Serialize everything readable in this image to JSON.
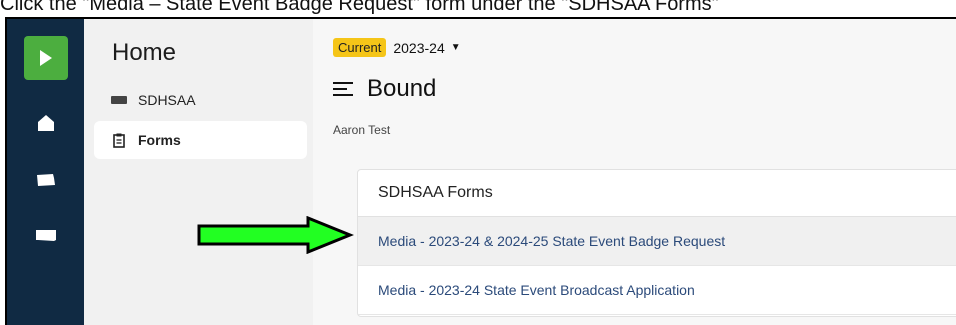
{
  "caption": "Click the \"Media – State Event Badge Request\" form under the \"SDHSAA Forms\"",
  "nav": {
    "title": "Home",
    "items": [
      {
        "label": "SDHSAA"
      },
      {
        "label": "Forms"
      }
    ]
  },
  "header": {
    "season_badge": "Current",
    "season": "2023-24",
    "title": "Bound",
    "user": "Aaron Test"
  },
  "forms": {
    "heading": "SDHSAA Forms",
    "items": [
      {
        "label": "Media - 2023-24 & 2024-25 State Event Badge Request"
      },
      {
        "label": "Media - 2023-24 State Event Broadcast Application"
      }
    ]
  },
  "colors": {
    "rail": "#102a43",
    "brand_green": "#4cae3f",
    "badge": "#f5c518",
    "link": "#2b4a7a",
    "arrow": "#22ff22"
  }
}
